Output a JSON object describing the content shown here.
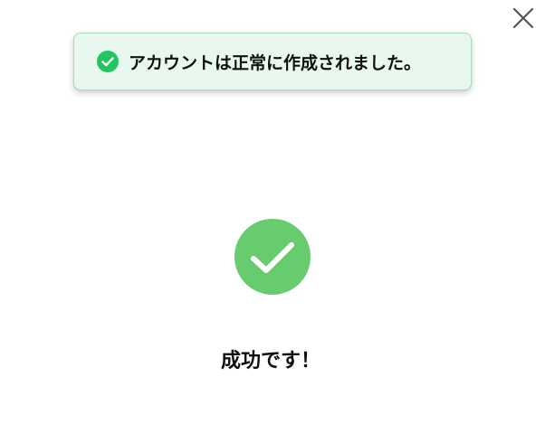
{
  "toast": {
    "message": "アカウントは正常に作成されました。",
    "status": "success",
    "icon": "check-circle-icon",
    "colors": {
      "background": "#e8f8ee",
      "border": "#a9dcb9",
      "icon": "#22c55e"
    }
  },
  "close": {
    "icon": "close-icon"
  },
  "result": {
    "icon": "check-circle-icon",
    "icon_color": "#66cc6e",
    "title": "成功です！"
  }
}
